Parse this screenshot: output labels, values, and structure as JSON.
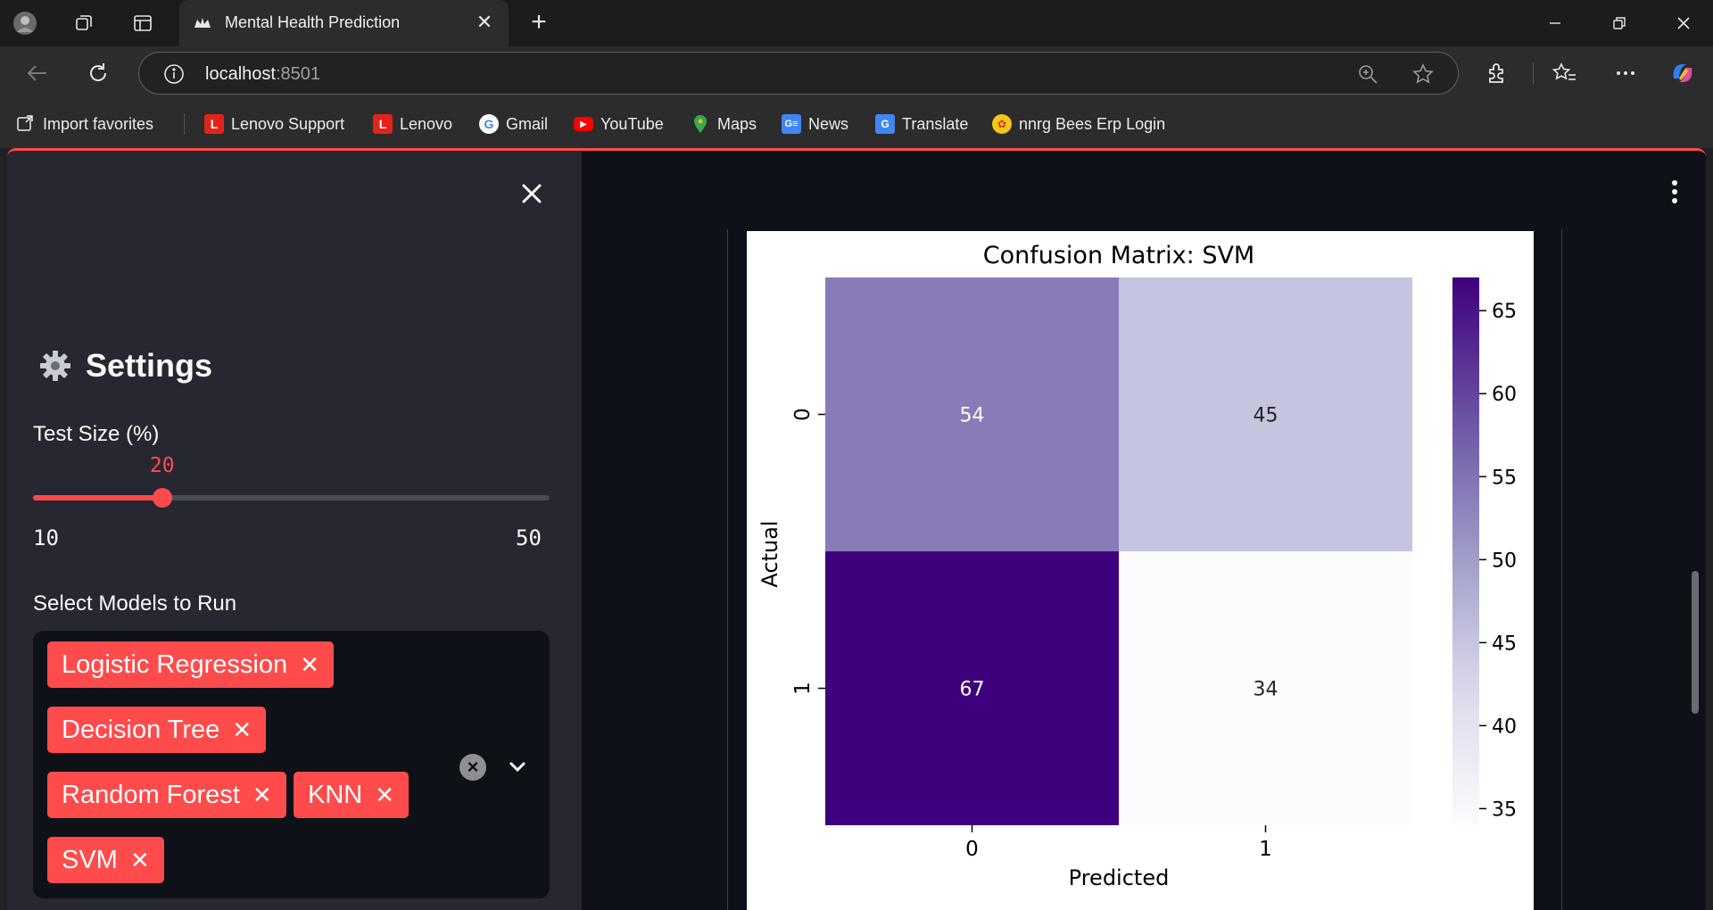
{
  "browser": {
    "tab_title": "Mental Health Prediction",
    "url_host": "localhost",
    "url_port": ":8501",
    "bookmarks": [
      {
        "label": "Import favorites",
        "icon": "import-icon"
      },
      {
        "label": "Lenovo Support",
        "icon": "lenovo-icon"
      },
      {
        "label": "Lenovo",
        "icon": "lenovo-icon"
      },
      {
        "label": "Gmail",
        "icon": "google-icon"
      },
      {
        "label": "YouTube",
        "icon": "youtube-icon"
      },
      {
        "label": "Maps",
        "icon": "maps-icon"
      },
      {
        "label": "News",
        "icon": "news-icon"
      },
      {
        "label": "Translate",
        "icon": "translate-icon"
      },
      {
        "label": "nnrg Bees Erp Login",
        "icon": "nnrg-icon"
      }
    ]
  },
  "sidebar": {
    "title": "Settings",
    "title_icon": "gear-icon",
    "test_size": {
      "label": "Test Size (%)",
      "value": "20",
      "min": "10",
      "max": "50",
      "fill_fraction": 0.25
    },
    "models": {
      "label": "Select Models to Run",
      "selected": [
        "Logistic Regression",
        "Decision Tree",
        "Random Forest",
        "KNN",
        "SVM"
      ]
    }
  },
  "colors": {
    "accent": "#ff4b4b",
    "sidebar_bg": "#262730",
    "main_bg": "#0e1117"
  },
  "chart_data": {
    "type": "heatmap",
    "title": "Confusion Matrix: SVM",
    "xlabel": "Predicted",
    "ylabel": "Actual",
    "x_categories": [
      "0",
      "1"
    ],
    "y_categories": [
      "0",
      "1"
    ],
    "values": [
      [
        54,
        45
      ],
      [
        67,
        34
      ]
    ],
    "colormap": "Purples",
    "colorbar": {
      "min": 34,
      "max": 67,
      "ticks": [
        "35",
        "40",
        "45",
        "50",
        "55",
        "60",
        "65"
      ]
    }
  }
}
